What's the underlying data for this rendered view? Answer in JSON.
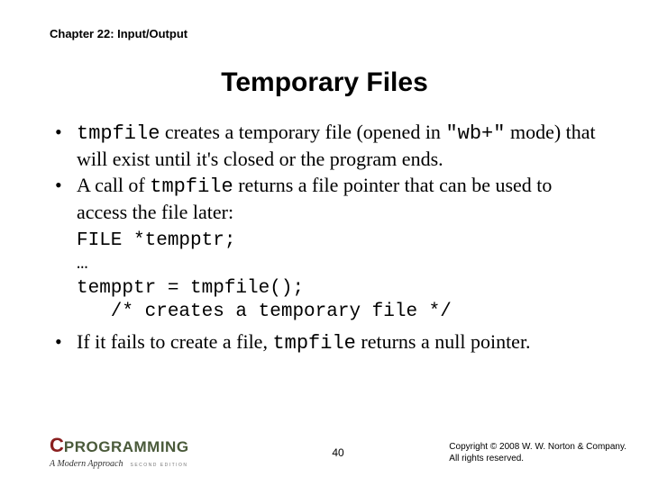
{
  "chapter": "Chapter 22: Input/Output",
  "title": "Temporary Files",
  "bullets": {
    "b1_part1": "tmpfile",
    "b1_part2": " creates a temporary file (opened in ",
    "b1_part3": "\"wb+\"",
    "b1_part4": " mode) that will exist until it's closed or the program ends.",
    "b2_part1": "A call of ",
    "b2_part2": "tmpfile",
    "b2_part3": " returns a file pointer that can be used to access the file later:",
    "b3_part1": "If it fails to create a file, ",
    "b3_part2": "tmpfile",
    "b3_part3": " returns a null pointer."
  },
  "code": "FILE *tempptr;\n…\ntempptr = tmpfile();\n   /* creates a temporary file */",
  "footer": {
    "logo_c": "C",
    "logo_prog": "PROGRAMMING",
    "logo_sub": "A Modern Approach",
    "logo_ed": "SECOND EDITION",
    "page": "40",
    "copyright_l1": "Copyright © 2008 W. W. Norton & Company.",
    "copyright_l2": "All rights reserved."
  }
}
